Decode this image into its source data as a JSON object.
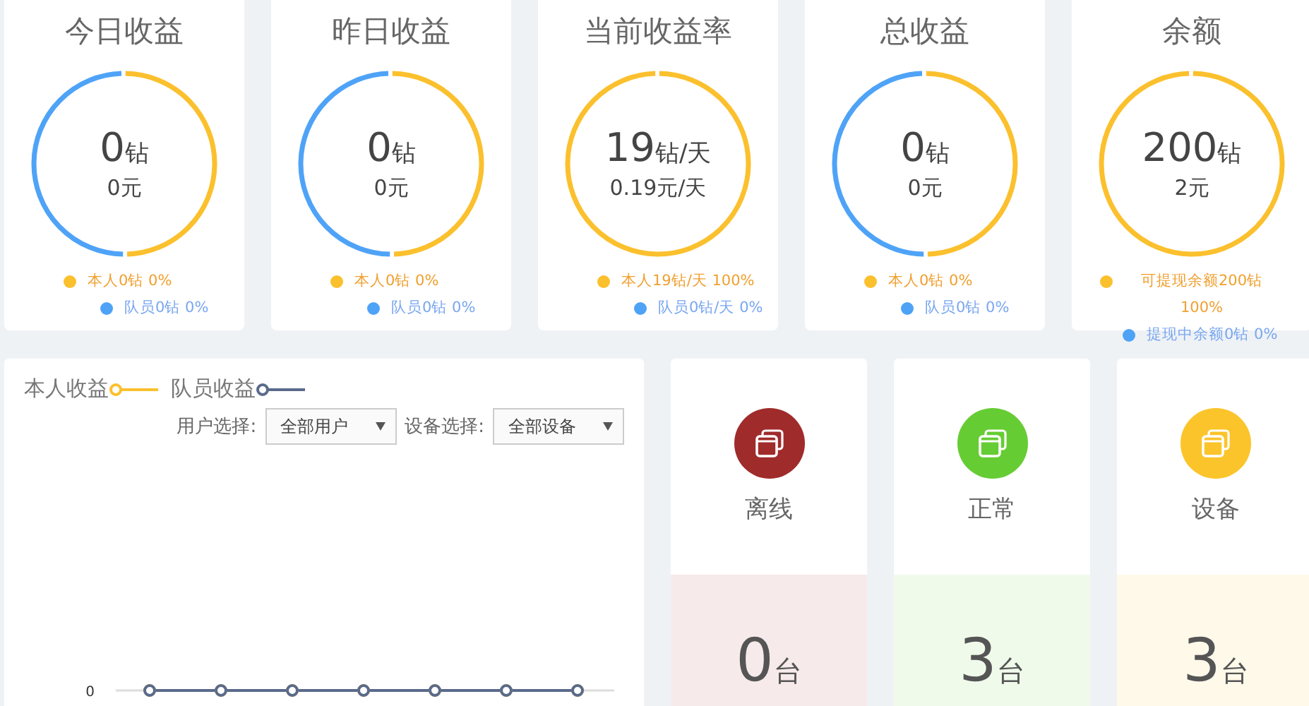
{
  "stat_cards": [
    {
      "title": "今日收益",
      "kind": "split",
      "value": "0",
      "unit": "钻",
      "sub": "0元",
      "legend": [
        {
          "text": "本人0钻",
          "percent": "0%",
          "color": "#fbc02d"
        },
        {
          "text": "队员0钻",
          "percent": "0%",
          "color": "#4fa3f7"
        }
      ]
    },
    {
      "title": "昨日收益",
      "kind": "split",
      "value": "0",
      "unit": "钻",
      "sub": "0元",
      "legend": [
        {
          "text": "本人0钻",
          "percent": "0%",
          "color": "#fbc02d"
        },
        {
          "text": "队员0钻",
          "percent": "0%",
          "color": "#4fa3f7"
        }
      ]
    },
    {
      "title": "当前收益率",
      "kind": "full",
      "value": "19",
      "unit": "钻/天",
      "sub": "0.19元/天",
      "legend": [
        {
          "text": "本人19钻/天",
          "percent": "100%",
          "color": "#fbc02d"
        },
        {
          "text": "队员0钻/天",
          "percent": "0%",
          "color": "#4fa3f7"
        }
      ]
    },
    {
      "title": "总收益",
      "kind": "split",
      "value": "0",
      "unit": "钻",
      "sub": "0元",
      "legend": [
        {
          "text": "本人0钻",
          "percent": "0%",
          "color": "#fbc02d"
        },
        {
          "text": "队员0钻",
          "percent": "0%",
          "color": "#4fa3f7"
        }
      ]
    },
    {
      "title": "余额",
      "kind": "full",
      "value": "200",
      "unit": "钻",
      "sub": "2元",
      "legend": [
        {
          "text": "可提现余额200钻",
          "percent": "100%",
          "color": "#fbc02d"
        },
        {
          "text": "提现中余额0钻",
          "percent": "0%",
          "color": "#4fa3f7"
        }
      ]
    }
  ],
  "income_chart": {
    "legend": [
      {
        "name": "本人收益",
        "color": "#fbc02d"
      },
      {
        "name": "队员收益",
        "color": "#5a6a8c"
      }
    ],
    "filters": [
      {
        "label": "用户选择:",
        "value": "全部用户"
      },
      {
        "label": "设备选择:",
        "value": "全部设备"
      }
    ],
    "axis_label": "0"
  },
  "device_cards": [
    {
      "label": "离线",
      "count": "0",
      "unit": "台",
      "color": "#a02b2b"
    },
    {
      "label": "正常",
      "count": "3",
      "unit": "台",
      "color": "#66cc33"
    },
    {
      "label": "设备",
      "count": "3",
      "unit": "台",
      "color": "#fbc42a"
    }
  ]
}
